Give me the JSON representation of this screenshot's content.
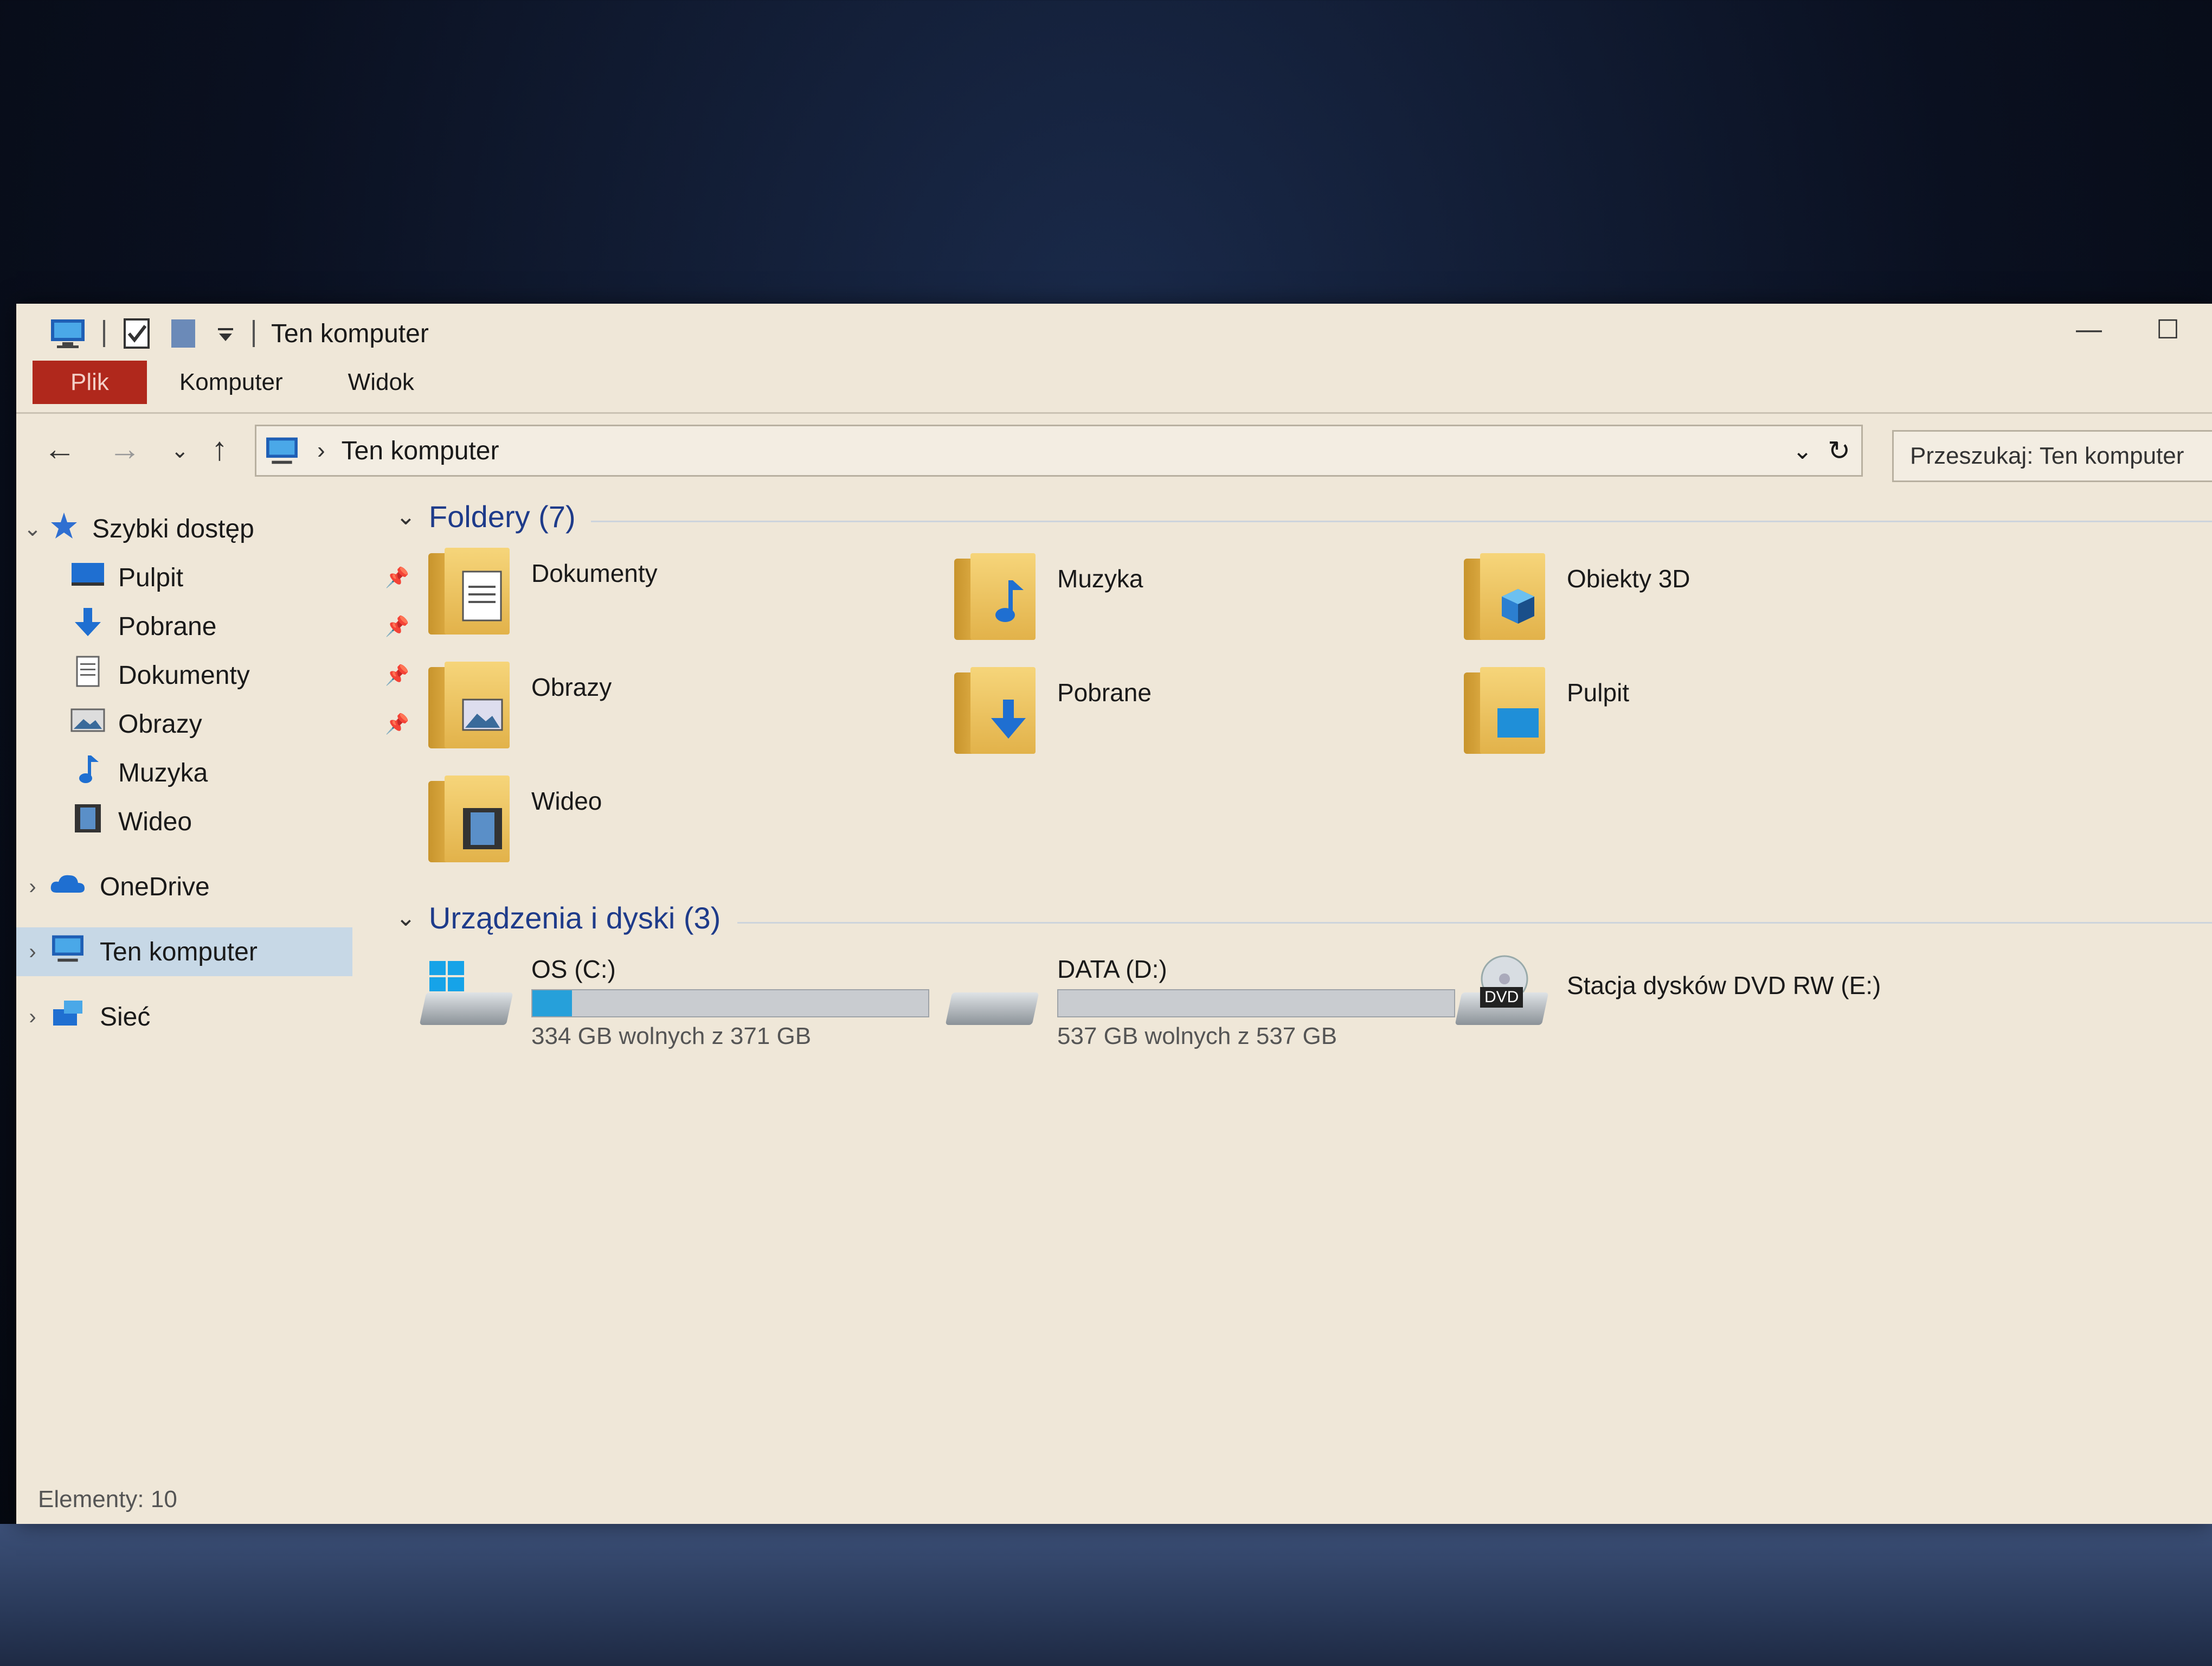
{
  "window": {
    "title": "Ten komputer",
    "items_status": "Elementy: 10"
  },
  "ribbon": {
    "tabs": [
      {
        "label": "Plik"
      },
      {
        "label": "Komputer"
      },
      {
        "label": "Widok"
      }
    ]
  },
  "address": {
    "path": "Ten komputer",
    "search_placeholder": "Przeszukaj: Ten komputer"
  },
  "nav": {
    "quick_access": "Szybki dostęp",
    "pinned": [
      {
        "label": "Pulpit",
        "icon": "desktop-icon"
      },
      {
        "label": "Pobrane",
        "icon": "download-icon"
      },
      {
        "label": "Dokumenty",
        "icon": "document-icon"
      },
      {
        "label": "Obrazy",
        "icon": "picture-icon"
      },
      {
        "label": "Muzyka",
        "icon": "music-icon"
      },
      {
        "label": "Wideo",
        "icon": "video-icon"
      }
    ],
    "onedrive": "OneDrive",
    "this_pc": "Ten komputer",
    "network": "Sieć"
  },
  "folders": {
    "header": "Foldery (7)",
    "items": [
      {
        "label": "Dokumenty",
        "icon": "document-icon"
      },
      {
        "label": "Muzyka",
        "icon": "music-icon"
      },
      {
        "label": "Obiekty 3D",
        "icon": "cube-icon"
      },
      {
        "label": "Obrazy",
        "icon": "picture-icon"
      },
      {
        "label": "Pobrane",
        "icon": "download-icon"
      },
      {
        "label": "Pulpit",
        "icon": "desktop-icon"
      },
      {
        "label": "Wideo",
        "icon": "video-icon"
      }
    ]
  },
  "drives": {
    "header": "Urządzenia i dyski (3)",
    "items": [
      {
        "name": "OS (C:)",
        "free": "334 GB wolnych z 371 GB",
        "used_fraction": 0.1
      },
      {
        "name": "DATA (D:)",
        "free": "537 GB wolnych z 537 GB",
        "used_fraction": 0.0
      },
      {
        "name": "Stacja dysków DVD RW (E:)",
        "badge": "DVD"
      }
    ]
  },
  "colors": {
    "accent": "#26a0da",
    "file_tab": "#b0281c",
    "group_header": "#1e3b8a"
  }
}
